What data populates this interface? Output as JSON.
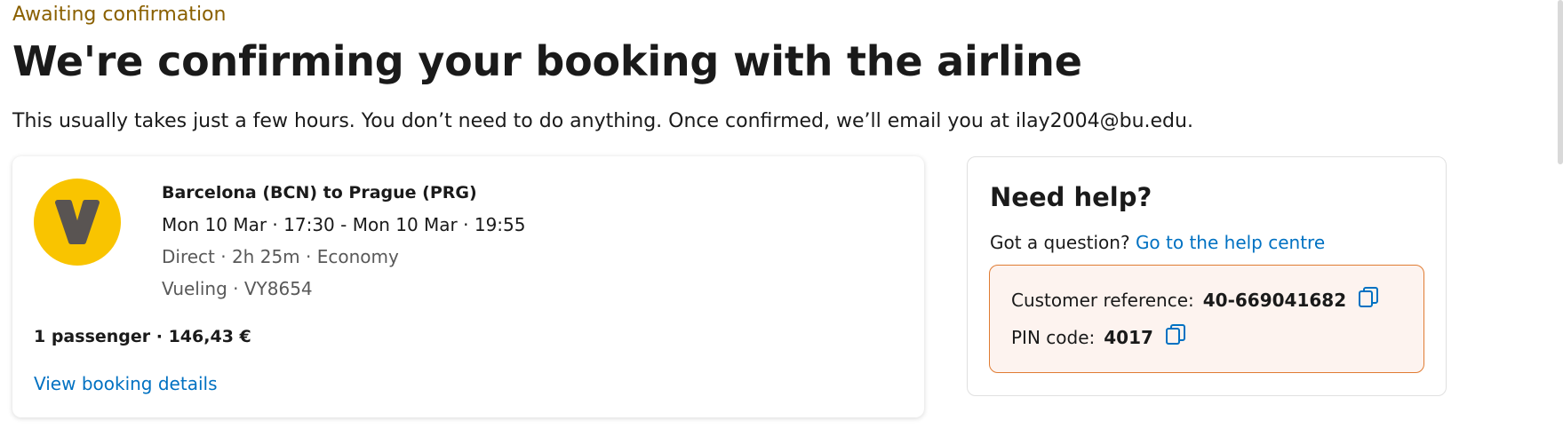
{
  "header": {
    "status": "Awaiting confirmation",
    "title": "We're confirming your booking with the airline",
    "subtitle": "This usually takes just a few hours. You don’t need to do anything. Once confirmed, we’ll email you at ilay2004@bu.edu."
  },
  "booking": {
    "airline_logo_icon": "vueling-logo",
    "route": "Barcelona (BCN) to Prague (PRG)",
    "times": "Mon 10 Mar · 17:30 - Mon 10 Mar · 19:55",
    "details": "Direct · 2h 25m · Economy",
    "flight": "Vueling · VY8654",
    "price": "1 passenger · 146,43 €",
    "view_link": "View booking details"
  },
  "help": {
    "title": "Need help?",
    "question": "Got a question?",
    "link": "Go to the help centre",
    "customer_reference_label": "Customer reference:",
    "customer_reference_value": "40-669041682",
    "pin_label": "PIN code:",
    "pin_value": "4017",
    "copy_icon": "copy-icon"
  },
  "colors": {
    "status": "#8a6000",
    "link": "#0071c2",
    "logo_bg": "#f9c400",
    "ref_box_bg": "#fdf3ef",
    "ref_box_border": "#e07c33"
  }
}
